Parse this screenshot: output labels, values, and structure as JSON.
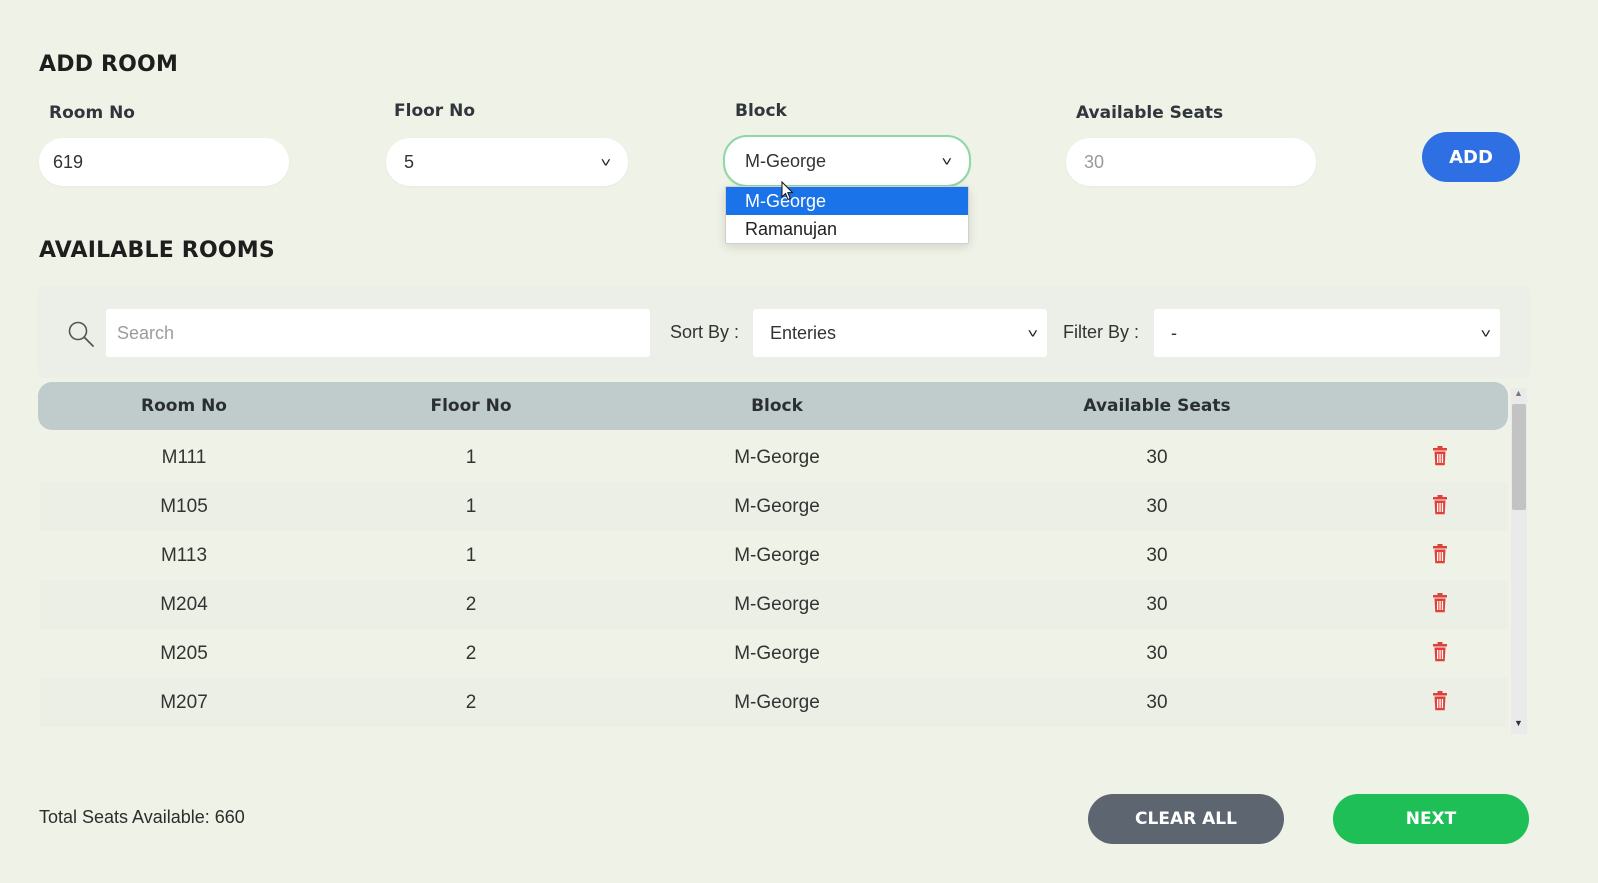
{
  "add_room": {
    "title": "ADD ROOM",
    "room_no": {
      "label": "Room No",
      "value": "619"
    },
    "floor_no": {
      "label": "Floor No",
      "value": "5"
    },
    "block": {
      "label": "Block",
      "value": "M-George",
      "options": [
        "M-George",
        "Ramanujan"
      ],
      "selected_option": "M-George"
    },
    "available_seats": {
      "label": "Available Seats",
      "placeholder": "30"
    },
    "add_label": "ADD"
  },
  "available_rooms": {
    "title": "AVAILABLE ROOMS",
    "search_placeholder": "Search",
    "sort_label": "Sort By :",
    "sort_value": "Enteries",
    "filter_label": "Filter By :",
    "filter_value": "-",
    "columns": [
      "Room No",
      "Floor No",
      "Block",
      "Available Seats"
    ],
    "rows": [
      {
        "room_no": "M111",
        "floor_no": "1",
        "block": "M-George",
        "seats": "30"
      },
      {
        "room_no": "M105",
        "floor_no": "1",
        "block": "M-George",
        "seats": "30"
      },
      {
        "room_no": "M113",
        "floor_no": "1",
        "block": "M-George",
        "seats": "30"
      },
      {
        "room_no": "M204",
        "floor_no": "2",
        "block": "M-George",
        "seats": "30"
      },
      {
        "room_no": "M205",
        "floor_no": "2",
        "block": "M-George",
        "seats": "30"
      },
      {
        "room_no": "M207",
        "floor_no": "2",
        "block": "M-George",
        "seats": "30"
      }
    ]
  },
  "footer": {
    "total_text": "Total Seats Available: 660",
    "clear_all_label": "CLEAR ALL",
    "next_label": "NEXT"
  },
  "colors": {
    "add_button": "#2f6fe4",
    "clear_button": "#5d6571",
    "next_button": "#1dbf56",
    "delete_icon": "#e0403a",
    "dropdown_selected": "#1a73e8"
  }
}
